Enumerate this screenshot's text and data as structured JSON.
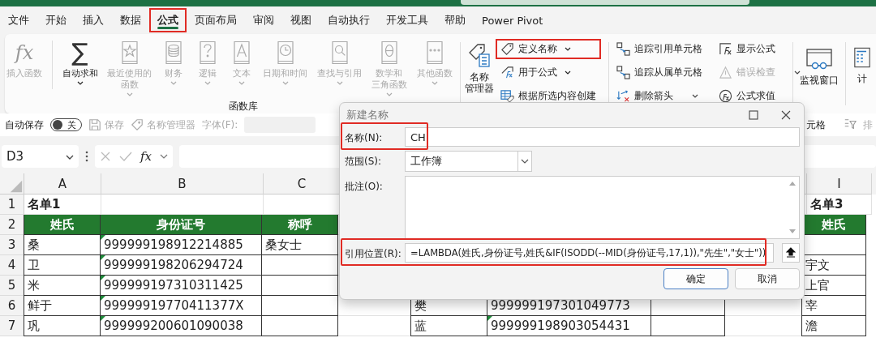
{
  "tabs": [
    {
      "label": "文件",
      "selected": false,
      "highlighted": false
    },
    {
      "label": "开始",
      "selected": false,
      "highlighted": false
    },
    {
      "label": "插入",
      "selected": false,
      "highlighted": false
    },
    {
      "label": "数据",
      "selected": false,
      "highlighted": false
    },
    {
      "label": "公式",
      "selected": true,
      "highlighted": true
    },
    {
      "label": "页面布局",
      "selected": false,
      "highlighted": false
    },
    {
      "label": "审阅",
      "selected": false,
      "highlighted": false
    },
    {
      "label": "视图",
      "selected": false,
      "highlighted": false
    },
    {
      "label": "自动执行",
      "selected": false,
      "highlighted": false
    },
    {
      "label": "开发工具",
      "selected": false,
      "highlighted": false
    },
    {
      "label": "帮助",
      "selected": false,
      "highlighted": false
    },
    {
      "label": "Power Pivot",
      "selected": false,
      "highlighted": false
    }
  ],
  "ribbon": {
    "function_library": {
      "label": "函数库",
      "items": [
        {
          "label": [
            "插入函数"
          ],
          "glyph": "fx",
          "disabled": true,
          "dropdown": false
        },
        {
          "label": [
            "自动求和"
          ],
          "glyph": "∑",
          "disabled": false,
          "dropdown": true
        },
        {
          "label": [
            "最近使用的",
            "函数"
          ],
          "disabled": true,
          "dropdown": true
        },
        {
          "label": [
            "财务"
          ],
          "disabled": true,
          "dropdown": true
        },
        {
          "label": [
            "逻辑"
          ],
          "disabled": true,
          "dropdown": true
        },
        {
          "label": [
            "文本"
          ],
          "disabled": true,
          "dropdown": true
        },
        {
          "label": [
            "日期和时间"
          ],
          "disabled": true,
          "dropdown": true
        },
        {
          "label": [
            "查找与引用"
          ],
          "disabled": true,
          "dropdown": true
        },
        {
          "label": [
            "数学和",
            "三角函数"
          ],
          "disabled": true,
          "dropdown": true
        },
        {
          "label": [
            "其他函数"
          ],
          "disabled": true,
          "dropdown": true
        }
      ]
    },
    "defined_names": {
      "manager": {
        "label": [
          "名称",
          "管理器"
        ]
      },
      "items": [
        {
          "label": "定义名称",
          "dropdown": true,
          "highlighted": true
        },
        {
          "label": "用于公式",
          "dropdown": true,
          "highlighted": false
        },
        {
          "label": "根据所选内容创建",
          "dropdown": false,
          "highlighted": false
        }
      ]
    },
    "formula_auditing": {
      "columns": [
        [
          {
            "label": "追踪引用单元格",
            "disabled": false,
            "dropdown": false
          },
          {
            "label": "追踪从属单元格",
            "disabled": false,
            "dropdown": false
          },
          {
            "label": "删除箭头",
            "disabled": false,
            "dropdown": true
          }
        ],
        [
          {
            "label": "显示公式",
            "disabled": false,
            "dropdown": false
          },
          {
            "label": "错误检查",
            "disabled": true,
            "dropdown": true
          },
          {
            "label": "公式求值",
            "disabled": false,
            "dropdown": false
          }
        ]
      ]
    },
    "watch": {
      "label": "监视窗口"
    },
    "calculation": {
      "label": "计"
    }
  },
  "quick_access": {
    "autosave": {
      "label": "自动保存",
      "on": false,
      "state_text": "关"
    },
    "items": [
      {
        "label": "保存",
        "disabled": true
      },
      {
        "label": "名称管理器",
        "disabled": true
      }
    ],
    "font_label": "字体(F):",
    "right_texts": [
      "元格",
      "排"
    ]
  },
  "formula_bar": {
    "name_box": "D3",
    "fx": "fx"
  },
  "sheet": {
    "column_headers": {
      "A": "A",
      "B": "B",
      "C": "C",
      "I": "I"
    },
    "rows": [
      {
        "number": "1",
        "kind": "title",
        "cells": {
          "A": {
            "text": "名单1",
            "flagged": false
          },
          "I": {
            "text": "名单3",
            "flagged": false
          }
        }
      },
      {
        "number": "2",
        "kind": "header",
        "cells": {
          "A": {
            "text": "姓氏",
            "flagged": false
          },
          "B": {
            "text": "身份证号",
            "flagged": false
          },
          "C": {
            "text": "称呼",
            "flagged": false
          },
          "I": {
            "text": "姓氏",
            "flagged": false
          }
        }
      },
      {
        "number": "3",
        "kind": "data",
        "cells": {
          "A": {
            "text": "桑",
            "flagged": false
          },
          "B": {
            "text": "999999198912214885",
            "flagged": true
          },
          "C": {
            "text": "桑女士",
            "flagged": false
          }
        }
      },
      {
        "number": "4",
        "kind": "data",
        "cells": {
          "A": {
            "text": "卫",
            "flagged": false
          },
          "B": {
            "text": "999999198206294724",
            "flagged": true
          },
          "I": {
            "text": "宇文",
            "flagged": false
          }
        }
      },
      {
        "number": "5",
        "kind": "data",
        "cells": {
          "A": {
            "text": "米",
            "flagged": false
          },
          "B": {
            "text": "999999197310311425",
            "flagged": true
          },
          "I": {
            "text": "上官",
            "flagged": false
          }
        }
      },
      {
        "number": "6",
        "kind": "data",
        "cells": {
          "A": {
            "text": "鲜于",
            "flagged": false
          },
          "B": {
            "text": "99999919770411377X",
            "flagged": true
          },
          "E": {
            "text": "樊"
          },
          "F": {
            "text": "999999197301049773"
          },
          "I": {
            "text": "宰",
            "flagged": false
          }
        }
      },
      {
        "number": "7",
        "kind": "data",
        "cells": {
          "A": {
            "text": "巩",
            "flagged": false
          },
          "B": {
            "text": "999999200601090038",
            "flagged": true
          },
          "E": {
            "text": "蓝",
            "flagged": false
          },
          "F": {
            "text": "999999198903054431",
            "flagged": true
          },
          "I": {
            "text": "澹",
            "flagged": false
          }
        }
      }
    ]
  },
  "dialog": {
    "title": "新建名称",
    "fields": [
      {
        "label": "名称(N):",
        "kind": "text",
        "value": "CH",
        "highlighted": true
      },
      {
        "label": "范围(S):",
        "kind": "select",
        "value": "工作簿",
        "highlighted": false
      },
      {
        "label": "批注(O):",
        "kind": "textarea",
        "highlighted": false
      },
      {
        "label": "引用位置(R):",
        "kind": "formula",
        "value": "=LAMBDA(姓氏,身份证号,姓氏&IF(ISODD(--MID(身份证号,17,1)),\"先生\",\"女士\"))",
        "highlighted": true
      }
    ],
    "buttons": [
      {
        "label": "确定",
        "default": true
      },
      {
        "label": "取消",
        "default": false
      }
    ]
  }
}
